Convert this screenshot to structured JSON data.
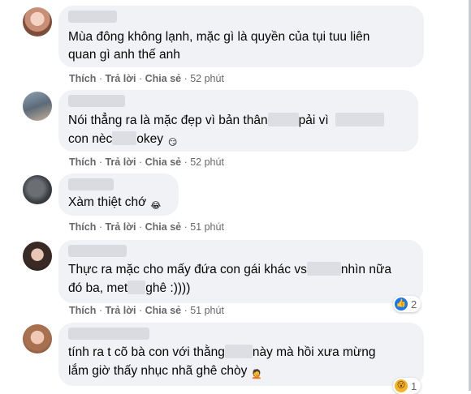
{
  "actions": {
    "like": "Thích",
    "reply": "Trả lời",
    "share": "Chia sẻ",
    "sep": " · "
  },
  "comments": [
    {
      "line1": "Mùa đông không lạnh, mặc gì là quyền của tụi tuu liên",
      "line2": "quan gì anh thế anh",
      "time": "52 phút"
    },
    {
      "line1a": "Nói thẳng ra là mặc đẹp vì bản thân",
      "line1b": "pải vì",
      "line2a": "con nèc",
      "line2b": "okey",
      "time": "52 phút"
    },
    {
      "line1": "Xàm thiệt chớ",
      "time": "51 phút"
    },
    {
      "line1a": "Thực ra mặc cho mấy đứa con gái khác vs",
      "line1b": "nhìn nữa",
      "line2a": "đó ba, met",
      "line2b": "ghê :))))",
      "time": "51 phút",
      "reactions": "2"
    },
    {
      "line1a": "tính ra t cõ bà con với thằng",
      "line1b": "này mà hồi xưa mừng",
      "line2": "lắm giờ thấy nhục nhã ghê chòy",
      "reactions": "1"
    }
  ],
  "icons": {
    "emoji_smirk": "😏",
    "emoji_laugh": "😂",
    "emoji_facepalm": "🤦",
    "react_like": "like-icon",
    "react_wow": "wow-icon"
  },
  "colors": {
    "bubble": "#f0f2f5",
    "meta": "#65676b",
    "like": "#1877f2",
    "wow": "#f7b125"
  }
}
